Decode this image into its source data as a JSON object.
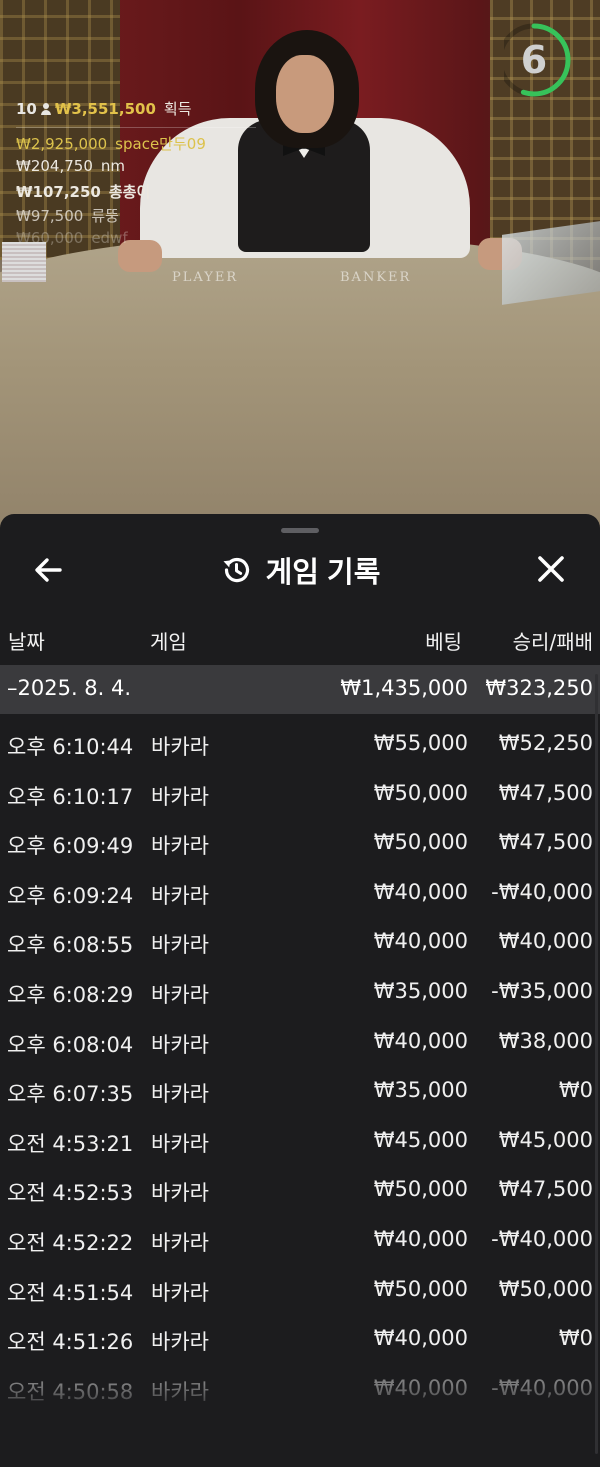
{
  "video": {
    "felt_player_label": "PLAYER",
    "felt_banker_label": "BANKER",
    "timer_value": "6",
    "timer_progress": 0.55,
    "timer_color": "#37c25a"
  },
  "winners": {
    "count": "10",
    "total": "₩3,551,500",
    "total_word": "획득",
    "rows": [
      {
        "amount": "₩2,925,000",
        "name": "space만두09"
      },
      {
        "amount": "₩204,750",
        "name": "nm"
      },
      {
        "amount": "₩107,250",
        "name": "총총이"
      },
      {
        "amount": "₩97,500",
        "name": "류뚱"
      },
      {
        "amount": "₩60,000",
        "name": "edwf"
      }
    ]
  },
  "sheet": {
    "title": "게임 기록",
    "back_icon": "arrow-left-icon",
    "history_icon": "history-icon",
    "close_icon": "close-icon",
    "columns": {
      "date": "날짜",
      "game": "게임",
      "bet": "베팅",
      "winloss": "승리/패배"
    },
    "day_summary": {
      "date": "–2025. 8. 4.",
      "bet": "₩1,435,000",
      "winloss": "₩323,250"
    },
    "rows": [
      {
        "time": "오후 6:10:44",
        "game": "바카라",
        "bet": "₩55,000",
        "winloss": "₩52,250"
      },
      {
        "time": "오후 6:10:17",
        "game": "바카라",
        "bet": "₩50,000",
        "winloss": "₩47,500"
      },
      {
        "time": "오후 6:09:49",
        "game": "바카라",
        "bet": "₩50,000",
        "winloss": "₩47,500"
      },
      {
        "time": "오후 6:09:24",
        "game": "바카라",
        "bet": "₩40,000",
        "winloss": "-₩40,000"
      },
      {
        "time": "오후 6:08:55",
        "game": "바카라",
        "bet": "₩40,000",
        "winloss": "₩40,000"
      },
      {
        "time": "오후 6:08:29",
        "game": "바카라",
        "bet": "₩35,000",
        "winloss": "-₩35,000"
      },
      {
        "time": "오후 6:08:04",
        "game": "바카라",
        "bet": "₩40,000",
        "winloss": "₩38,000"
      },
      {
        "time": "오후 6:07:35",
        "game": "바카라",
        "bet": "₩35,000",
        "winloss": "₩0"
      },
      {
        "time": "오전 4:53:21",
        "game": "바카라",
        "bet": "₩45,000",
        "winloss": "₩45,000"
      },
      {
        "time": "오전 4:52:53",
        "game": "바카라",
        "bet": "₩50,000",
        "winloss": "₩47,500"
      },
      {
        "time": "오전 4:52:22",
        "game": "바카라",
        "bet": "₩40,000",
        "winloss": "-₩40,000"
      },
      {
        "time": "오전 4:51:54",
        "game": "바카라",
        "bet": "₩50,000",
        "winloss": "₩50,000"
      },
      {
        "time": "오전 4:51:26",
        "game": "바카라",
        "bet": "₩40,000",
        "winloss": "₩0"
      },
      {
        "time": "오전 4:50:58",
        "game": "바카라",
        "bet": "₩40,000",
        "winloss": "-₩40,000"
      }
    ]
  }
}
